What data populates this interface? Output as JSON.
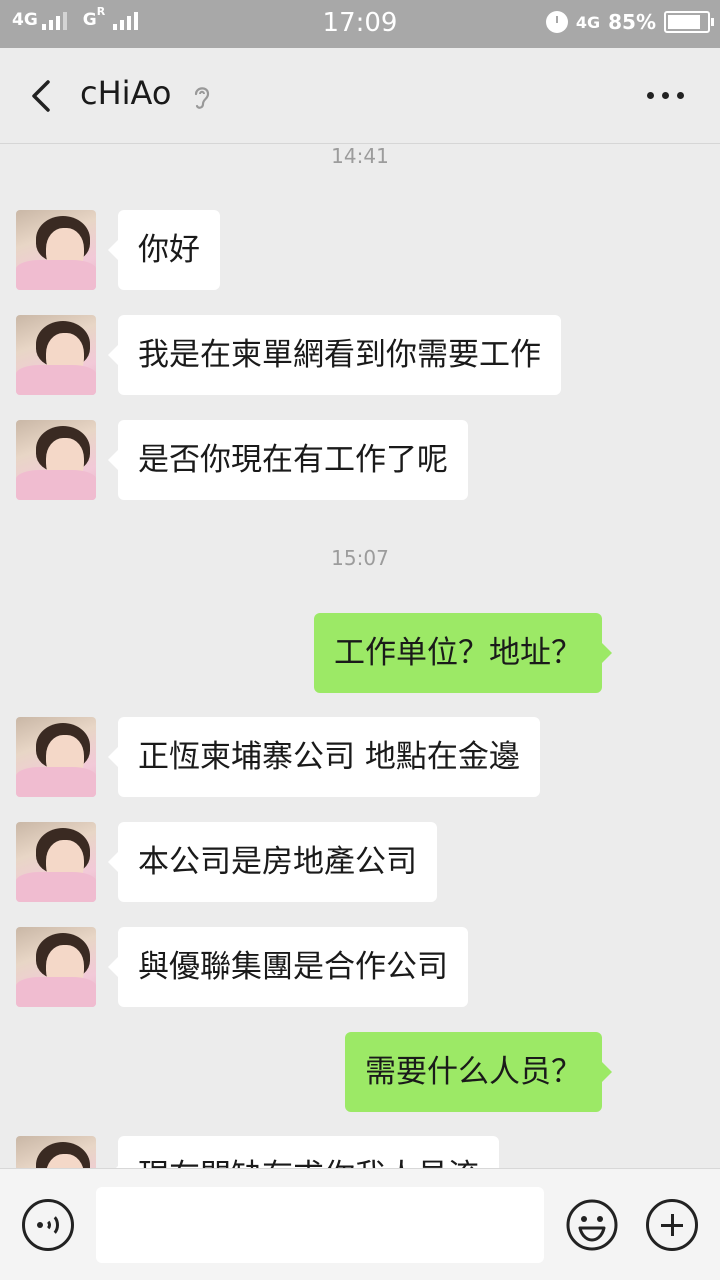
{
  "status_bar": {
    "network_1": "4G",
    "network_2": "G",
    "roaming": "R",
    "time": "17:09",
    "network_3": "4G",
    "battery": "85%",
    "battery_level": 0.85
  },
  "header": {
    "title": "cHiAo"
  },
  "chat": {
    "timestamps": [
      "14:41",
      "15:07"
    ],
    "messages": [
      {
        "side": "in",
        "text": "你好"
      },
      {
        "side": "in",
        "text": "我是在柬單網看到你需要工作"
      },
      {
        "side": "in",
        "text": "是否你現在有工作了呢"
      },
      {
        "side": "out",
        "text": "工作单位？地址？"
      },
      {
        "side": "in",
        "text": "正恆柬埔寨公司 地點在金邊"
      },
      {
        "side": "in",
        "text": "本公司是房地產公司"
      },
      {
        "side": "in",
        "text": "與優聯集團是合作公司"
      },
      {
        "side": "out",
        "text": "需要什么人员？"
      },
      {
        "side": "in",
        "text": "現在門缺有求你我人員流"
      }
    ]
  },
  "input_bar": {
    "placeholder": ""
  },
  "colors": {
    "outgoing_bubble": "#9ce966",
    "incoming_bubble": "#ffffff",
    "background": "#ececec",
    "status_bar": "#a8a8a8"
  }
}
